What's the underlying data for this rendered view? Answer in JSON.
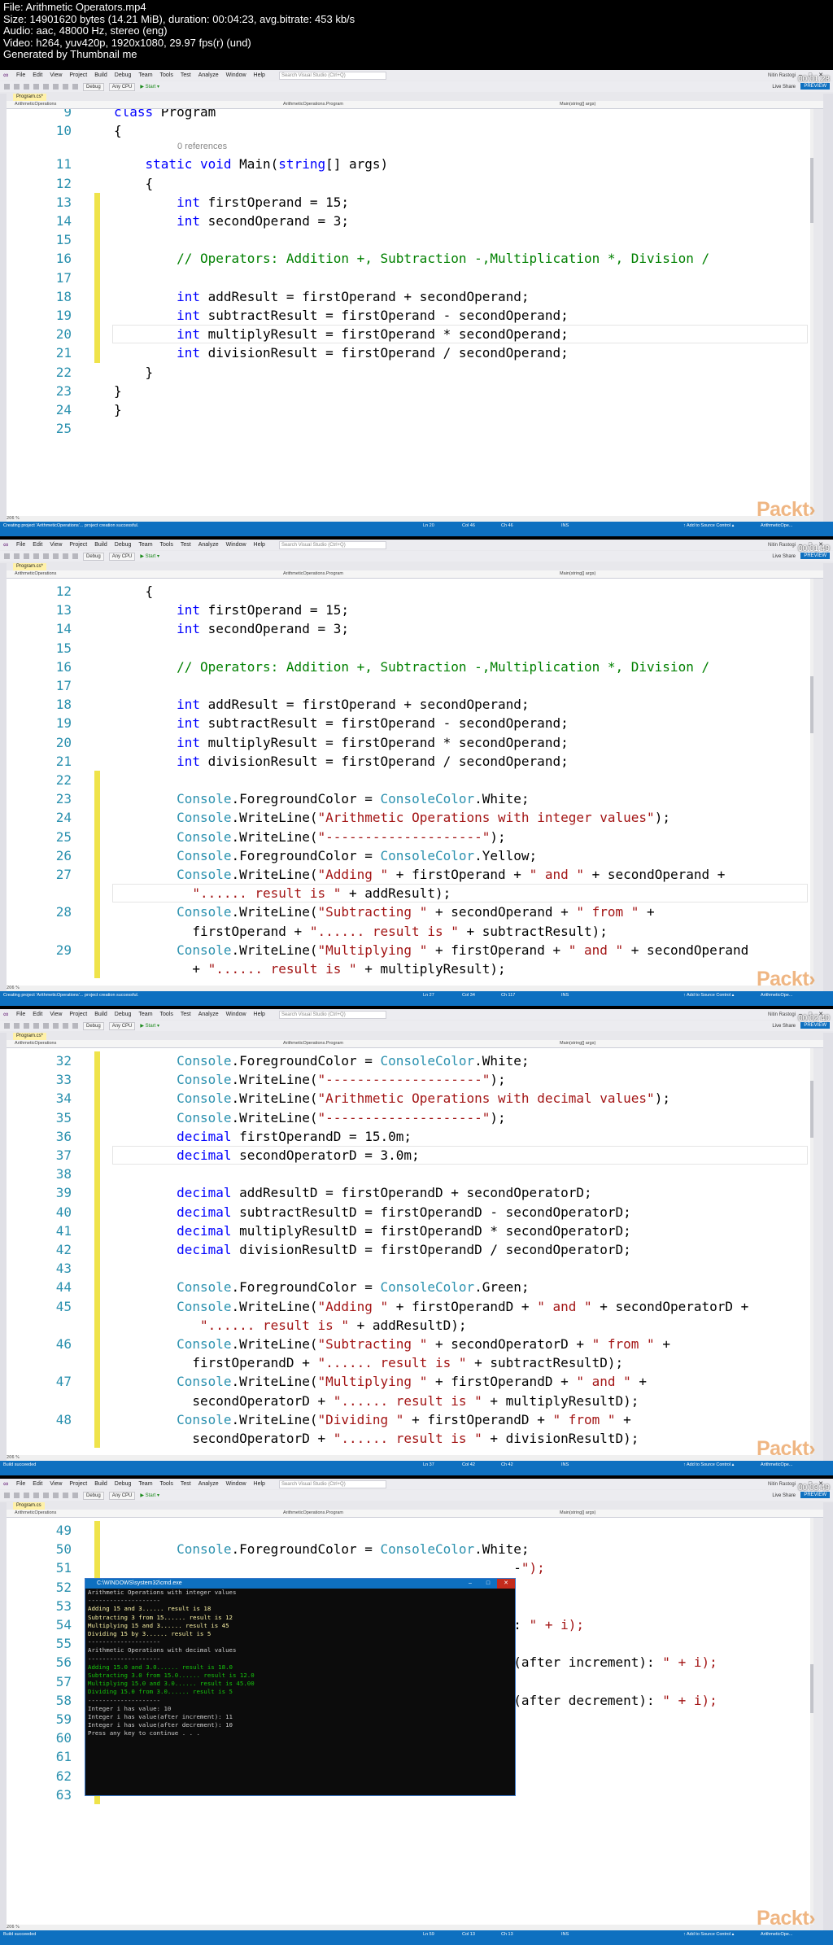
{
  "file_info": [
    "File: Arithmetic Operators.mp4",
    "Size: 14901620 bytes (14.21 MiB), duration: 00:04:23, avg.bitrate: 453 kb/s",
    "Audio: aac, 48000 Hz, stereo (eng)",
    "Video: h264, yuv420p, 1920x1080, 29.97 fps(r) (und)",
    "Generated by Thumbnail me"
  ],
  "ide": {
    "menu": [
      "File",
      "Edit",
      "View",
      "Project",
      "Build",
      "Debug",
      "Team",
      "Tools",
      "Test",
      "Analyze",
      "Window",
      "Help"
    ],
    "search_placeholder": "Search Visual Studio (Ctrl+Q)",
    "user": "Nitin Rastogi",
    "config": "Debug",
    "platform": "Any CPU",
    "start_label": "▶ Start ▾",
    "live_share": "Live Share",
    "preview": "PREVIEW",
    "nav_project": "ArithmeticOperations",
    "nav_class": "ArithmeticOperations.Program",
    "nav_member": "Main(string[] args)",
    "zoom": "206 %",
    "add_source": "↑ Add to Source Control ▴",
    "repo": "ArithmeticOpe...",
    "refs": "0 references",
    "logo": "Packt›"
  },
  "colors": {
    "keyword": "#0000ff",
    "type": "#2b91af",
    "string": "#a31515",
    "comment": "#008000",
    "linenum": "#2b91af",
    "change": "#efe34a",
    "status": "#0e70c0"
  },
  "frames": [
    {
      "tab": "Program.cs*",
      "status": "Creating project 'ArithmeticOperations'... project creation successful.",
      "ln": "Ln 20",
      "col": "Col 46",
      "ch": "Ch 46",
      "mode": "INS",
      "timestamp": "00:01:28",
      "lines": [
        {
          "n": "9",
          "t": "class Program"
        },
        {
          "n": "10",
          "t": "{"
        },
        {
          "n": "11",
          "t": "    static void Main(string[] args)"
        },
        {
          "n": "12",
          "t": "    {"
        },
        {
          "n": "13",
          "t": "        int firstOperand = 15;"
        },
        {
          "n": "14",
          "t": "        int secondOperand = 3;"
        },
        {
          "n": "15",
          "t": ""
        },
        {
          "n": "16",
          "t": "        // Operators: Addition +, Subtraction -,Multiplication *, Division /"
        },
        {
          "n": "17",
          "t": ""
        },
        {
          "n": "18",
          "t": "        int addResult = firstOperand + secondOperand;"
        },
        {
          "n": "19",
          "t": "        int subtractResult = firstOperand - secondOperand;"
        },
        {
          "n": "20",
          "t": "        int multiplyResult = firstOperand * secondOperand;"
        },
        {
          "n": "21",
          "t": "        int divisionResult = firstOperand / secondOperand;"
        },
        {
          "n": "22",
          "t": "    }"
        },
        {
          "n": "23",
          "t": "}"
        },
        {
          "n": "24",
          "t": "}"
        },
        {
          "n": "25",
          "t": ""
        }
      ]
    },
    {
      "tab": "Program.cs*",
      "status": "Creating project 'ArithmeticOperations'... project creation successful.",
      "ln": "Ln 27",
      "col": "Col 34",
      "ch": "Ch 117",
      "mode": "INS",
      "timestamp": "00:01:49",
      "lines": [
        {
          "n": "12",
          "t": "    {"
        },
        {
          "n": "13",
          "t": "        int firstOperand = 15;"
        },
        {
          "n": "14",
          "t": "        int secondOperand = 3;"
        },
        {
          "n": "15",
          "t": ""
        },
        {
          "n": "16",
          "t": "        // Operators: Addition +, Subtraction -,Multiplication *, Division /"
        },
        {
          "n": "17",
          "t": ""
        },
        {
          "n": "18",
          "t": "        int addResult = firstOperand + secondOperand;"
        },
        {
          "n": "19",
          "t": "        int subtractResult = firstOperand - secondOperand;"
        },
        {
          "n": "20",
          "t": "        int multiplyResult = firstOperand * secondOperand;"
        },
        {
          "n": "21",
          "t": "        int divisionResult = firstOperand / secondOperand;"
        },
        {
          "n": "22",
          "t": ""
        },
        {
          "n": "23",
          "t": "        Console.ForegroundColor = ConsoleColor.White;"
        },
        {
          "n": "24",
          "t": "        Console.WriteLine(\"Arithmetic Operations with integer values\");"
        },
        {
          "n": "25",
          "t": "        Console.WriteLine(\"--------------------\");"
        },
        {
          "n": "26",
          "t": "        Console.ForegroundColor = ConsoleColor.Yellow;"
        },
        {
          "n": "27",
          "t": "        Console.WriteLine(\"Adding \" + firstOperand + \" and \" + secondOperand +"
        },
        {
          "n": "",
          "t": "          \"...... result is \" + addResult);"
        },
        {
          "n": "28",
          "t": "        Console.WriteLine(\"Subtracting \" + secondOperand + \" from \" +"
        },
        {
          "n": "",
          "t": "          firstOperand + \"...... result is \" + subtractResult);"
        },
        {
          "n": "29",
          "t": "        Console.WriteLine(\"Multiplying \" + firstOperand + \" and \" + secondOperand"
        },
        {
          "n": "",
          "t": "          + \"...... result is \" + multiplyResult);"
        }
      ]
    },
    {
      "tab": "Program.cs*",
      "status": "Build succeeded",
      "ln": "Ln 37",
      "col": "Col 42",
      "ch": "Ch 42",
      "mode": "INS",
      "timestamp": "00:02:40",
      "lines": [
        {
          "n": "32",
          "t": "        Console.ForegroundColor = ConsoleColor.White;"
        },
        {
          "n": "33",
          "t": "        Console.WriteLine(\"--------------------\");"
        },
        {
          "n": "34",
          "t": "        Console.WriteLine(\"Arithmetic Operations with decimal values\");"
        },
        {
          "n": "35",
          "t": "        Console.WriteLine(\"--------------------\");"
        },
        {
          "n": "36",
          "t": "        decimal firstOperandD = 15.0m;"
        },
        {
          "n": "37",
          "t": "        decimal secondOperatorD = 3.0m;"
        },
        {
          "n": "38",
          "t": ""
        },
        {
          "n": "39",
          "t": "        decimal addResultD = firstOperandD + secondOperatorD;"
        },
        {
          "n": "40",
          "t": "        decimal subtractResultD = firstOperandD - secondOperatorD;"
        },
        {
          "n": "41",
          "t": "        decimal multiplyResultD = firstOperandD * secondOperatorD;"
        },
        {
          "n": "42",
          "t": "        decimal divisionResultD = firstOperandD / secondOperatorD;"
        },
        {
          "n": "43",
          "t": ""
        },
        {
          "n": "44",
          "t": "        Console.ForegroundColor = ConsoleColor.Green;"
        },
        {
          "n": "45",
          "t": "        Console.WriteLine(\"Adding \" + firstOperandD + \" and \" + secondOperatorD +"
        },
        {
          "n": "",
          "t": "           \"...... result is \" + addResultD);"
        },
        {
          "n": "46",
          "t": "        Console.WriteLine(\"Subtracting \" + secondOperatorD + \" from \" +"
        },
        {
          "n": "",
          "t": "          firstOperandD + \"...... result is \" + subtractResultD);"
        },
        {
          "n": "47",
          "t": "        Console.WriteLine(\"Multiplying \" + firstOperandD + \" and \" +"
        },
        {
          "n": "",
          "t": "          secondOperatorD + \"...... result is \" + multiplyResultD);"
        },
        {
          "n": "48",
          "t": "        Console.WriteLine(\"Dividing \" + firstOperandD + \" from \" +"
        },
        {
          "n": "",
          "t": "          secondOperatorD + \"...... result is \" + divisionResultD);"
        }
      ]
    },
    {
      "tab": "Program.cs",
      "status": "Build succeeded",
      "ln": "Ln 59",
      "col": "Col 13",
      "ch": "Ch 13",
      "mode": "INS",
      "timestamp": "00:03:49",
      "lines": [
        {
          "n": "49",
          "t": ""
        },
        {
          "n": "50",
          "t": "        Console.ForegroundColor = ConsoleColor.White;"
        },
        {
          "n": "51",
          "t": "                                                   -\");"
        },
        {
          "n": "52",
          "t": ""
        },
        {
          "n": "53",
          "t": ""
        },
        {
          "n": "54",
          "t": "                                                   : \" + i);"
        },
        {
          "n": "55",
          "t": ""
        },
        {
          "n": "56",
          "t": "                                                   (after increment): \" + i);"
        },
        {
          "n": "57",
          "t": ""
        },
        {
          "n": "58",
          "t": "                                                   (after decrement): \" + i);"
        },
        {
          "n": "59",
          "t": ""
        },
        {
          "n": "60",
          "t": ""
        },
        {
          "n": "61",
          "t": "    }"
        },
        {
          "n": "62",
          "t": "    }"
        },
        {
          "n": "63",
          "t": ""
        }
      ],
      "console": {
        "title": "C:\\WINDOWS\\system32\\cmd.exe",
        "lines": [
          {
            "t": "Arithmetic Operations with integer values",
            "c": "#cccccc"
          },
          {
            "t": "--------------------",
            "c": "#cccccc"
          },
          {
            "t": "Adding 15 and 3...... result is 18",
            "c": "#f9f1a5"
          },
          {
            "t": "Subtracting 3 from 15...... result is 12",
            "c": "#f9f1a5"
          },
          {
            "t": "Multiplying 15 and 3...... result is 45",
            "c": "#f9f1a5"
          },
          {
            "t": "Dividing 15 by 3...... result is 5",
            "c": "#f9f1a5"
          },
          {
            "t": "--------------------",
            "c": "#cccccc"
          },
          {
            "t": "Arithmetic Operations with decimal values",
            "c": "#cccccc"
          },
          {
            "t": "--------------------",
            "c": "#cccccc"
          },
          {
            "t": "Adding 15.0 and 3.0...... result is 18.0",
            "c": "#16c60c"
          },
          {
            "t": "Subtracting 3.0 from 15.0...... result is 12.0",
            "c": "#16c60c"
          },
          {
            "t": "Multiplying 15.0 and 3.0...... result is 45.00",
            "c": "#16c60c"
          },
          {
            "t": "Dividing 15.0 from 3.0...... result is 5",
            "c": "#16c60c"
          },
          {
            "t": "--------------------",
            "c": "#cccccc"
          },
          {
            "t": "Integer i has value: 10",
            "c": "#cccccc"
          },
          {
            "t": "Integer i has value(after increment): 11",
            "c": "#cccccc"
          },
          {
            "t": "Integer i has value(after decrement): 10",
            "c": "#cccccc"
          },
          {
            "t": "Press any key to continue . . .",
            "c": "#cccccc"
          }
        ]
      }
    }
  ]
}
